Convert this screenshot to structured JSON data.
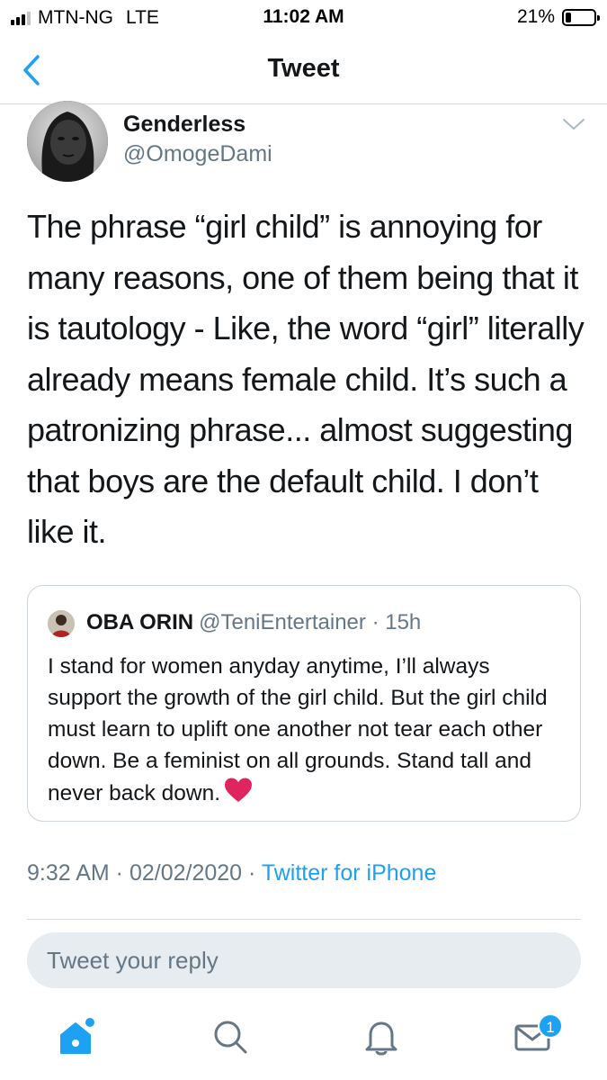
{
  "status_bar": {
    "carrier": "MTN-NG",
    "network": "LTE",
    "time": "11:02 AM",
    "battery": "21%",
    "battery_level": 0.21
  },
  "nav": {
    "title": "Tweet",
    "back_icon": "chevron-left-icon"
  },
  "tweet": {
    "author_name": "Genderless",
    "author_handle": "@OmogeDami",
    "text": "The phrase “girl child” is annoying for many reasons, one of them being that it is tautology - Like, the word “girl” literally already means female child. It’s such a patronizing phrase... almost suggesting that boys are the default child. I don’t like it.",
    "timestamp": "9:32 AM · 02/02/2020 · ",
    "source": "Twitter for iPhone"
  },
  "quote": {
    "name": "OBA ORIN",
    "handle": "@TeniEntertainer · 15h",
    "text": "I stand for women anyday anytime, I’ll always support the growth of the girl child. But the girl child must learn to uplift one another not tear each other down. Be a feminist on all grounds. Stand tall and never back down.",
    "emoji": "red-heart-icon"
  },
  "reply": {
    "placeholder": "Tweet your reply"
  },
  "tab_bar": {
    "items": [
      "home-icon",
      "search-icon",
      "notifications-icon",
      "messages-icon"
    ],
    "messages_badge": "1"
  },
  "colors": {
    "accent": "#1da1f2",
    "secondary_text": "#657786",
    "reply_bg": "#e6ecf0",
    "heart": "#e0245e"
  }
}
